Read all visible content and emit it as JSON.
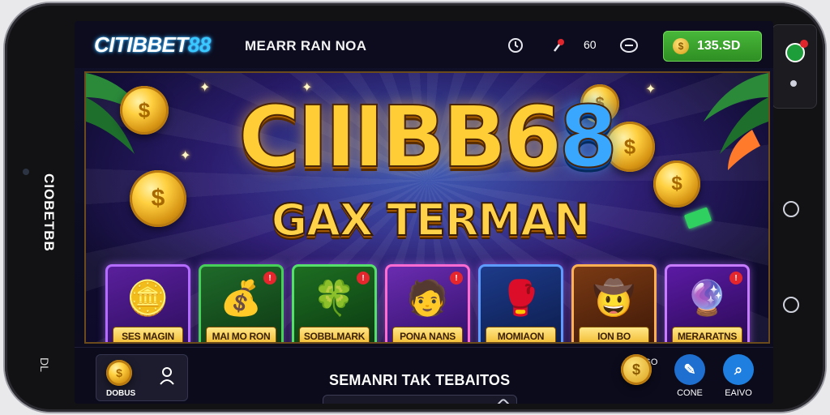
{
  "device": {
    "side_label": "CIOBETBB",
    "side_hw": "DL"
  },
  "header": {
    "logo_main": "CITIBBET",
    "logo_accent": "88",
    "tagline": "MEARR RAN NOA",
    "counter": "60",
    "balance": "135.SD"
  },
  "banner": {
    "title_gold": "CIIIBB6",
    "title_blue": "8",
    "subtitle": "GAX TERMAN"
  },
  "games": [
    {
      "label": "SES MAGIN",
      "badge": ""
    },
    {
      "label": "MAI MO RON",
      "badge": "!"
    },
    {
      "label": "SOBBLMARK",
      "badge": "!"
    },
    {
      "label": "PONA NANS",
      "badge": "!"
    },
    {
      "label": "MOMIAON",
      "badge": ""
    },
    {
      "label": "ION BO",
      "badge": ""
    },
    {
      "label": "MERARATNS",
      "badge": "!"
    }
  ],
  "bottom": {
    "promo_label": "DOBUS",
    "news_title": "SEMANRI TAK TEBAITOS",
    "nav": [
      {
        "label": "MASGO",
        "color": "#d9a21a"
      },
      {
        "label": "CONE",
        "color": "#1f6fd0"
      },
      {
        "label": "EAIVO",
        "color": "#1f7fe0"
      }
    ]
  },
  "icons": [
    "refresh-icon",
    "pin-icon",
    "chat-icon",
    "coin-icon",
    "user-icon",
    "search-icon"
  ]
}
